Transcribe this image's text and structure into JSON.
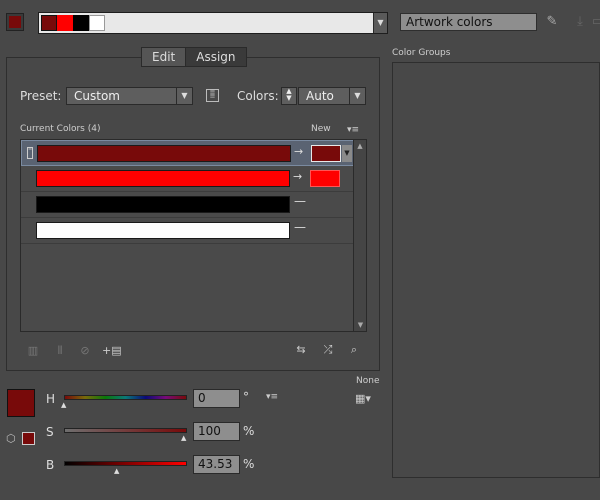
{
  "topbar": {
    "current_color": "#780a0a",
    "harmony_chips": [
      "#780a0a",
      "#ff0000",
      "#000000",
      "#ffffff"
    ],
    "name_value": "Artwork colors"
  },
  "tabs": [
    {
      "label": "Edit",
      "active": false
    },
    {
      "label": "Assign",
      "active": true
    }
  ],
  "preset": {
    "label": "Preset:",
    "value": "Custom"
  },
  "colors": {
    "label": "Colors:",
    "value": "Auto"
  },
  "current_colors": {
    "label": "Current Colors (4)",
    "new_label": "New"
  },
  "rows": [
    {
      "current": "#780a0a",
      "new": "#780a0a",
      "mapped": true
    },
    {
      "current": "#ff0000",
      "new": "#ff0000",
      "mapped": true
    },
    {
      "current": "#000000",
      "new": null,
      "mapped": false
    },
    {
      "current": "#ffffff",
      "new": null,
      "mapped": false
    }
  ],
  "none_label": "None",
  "hsb": {
    "h": {
      "label": "H",
      "value": "0",
      "unit": "°",
      "level": 0.0
    },
    "s": {
      "label": "S",
      "value": "100",
      "unit": "%",
      "level": 1.0
    },
    "b": {
      "label": "B",
      "value": "43.53",
      "unit": "%",
      "level": 0.4353
    }
  },
  "color_groups": {
    "label": "Color Groups"
  },
  "icons": [
    "dropdown-arrow-icon",
    "eyedropper-icon",
    "save-group-icon",
    "new-group-icon",
    "color-library-icon",
    "menu-icon",
    "random-order-icon",
    "random-saturation-icon",
    "find-color-icon",
    "merge-colors-icon",
    "separate-colors-icon",
    "exclude-icon",
    "new-row-icon",
    "cube-icon",
    "grid-icon"
  ]
}
